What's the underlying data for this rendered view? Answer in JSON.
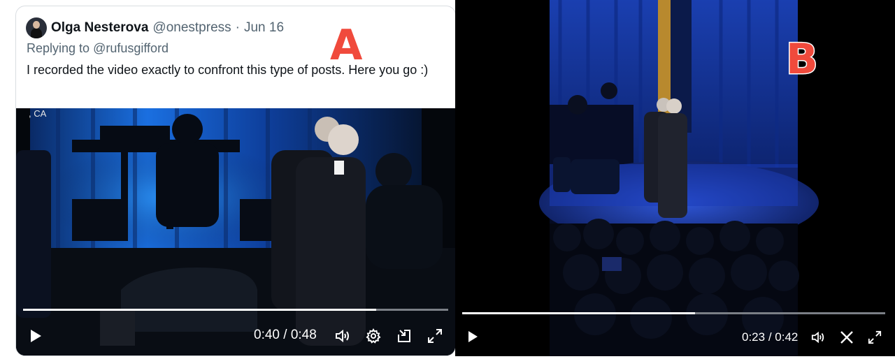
{
  "panel_a": {
    "label": "A",
    "author": {
      "name": "Olga Nesterova",
      "handle": "@onestpress",
      "date": "Jun 16",
      "separator": "·"
    },
    "replying_prefix": "Replying to",
    "replying_handle": "@rufusgifford",
    "text": "I recorded the video exactly to confront this type of posts. Here you go :)",
    "video": {
      "location": ", CA",
      "current_time": "0:40",
      "duration": "0:48",
      "time_separator": " / ",
      "progress": 0.83,
      "icons": [
        "play-icon",
        "volume-icon",
        "settings-icon",
        "minimize-player-icon",
        "fullscreen-icon"
      ]
    }
  },
  "panel_b": {
    "label": "B",
    "video": {
      "current_time": "0:23",
      "duration": "0:42",
      "time_separator": " / ",
      "progress": 0.55,
      "icons": [
        "play-icon",
        "volume-icon",
        "x-logo-icon",
        "fullscreen-icon"
      ]
    }
  },
  "colors": {
    "badge": "#f04a3c",
    "stage_blue": "#1d5dd8",
    "handle_gray": "#536471"
  }
}
